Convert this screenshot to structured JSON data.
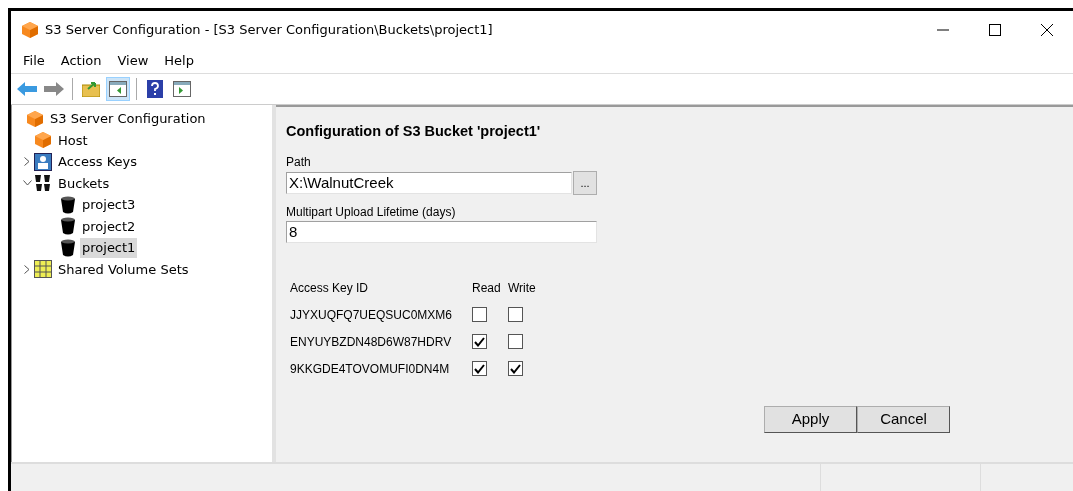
{
  "window": {
    "title": "S3 Server Configuration - [S3 Server Configuration\\Buckets\\project1]"
  },
  "menu": [
    "File",
    "Action",
    "View",
    "Help"
  ],
  "toolbar": [
    {
      "kind": "back",
      "selected": false
    },
    {
      "kind": "forward",
      "selected": false
    },
    {
      "kind": "up",
      "selected": false
    },
    {
      "kind": "pane",
      "selected": true
    },
    {
      "kind": "help",
      "selected": false
    },
    {
      "kind": "panel",
      "selected": false
    }
  ],
  "tree": [
    {
      "label": "S3 Server Configuration",
      "kind": "server",
      "selected": false,
      "children": [
        {
          "label": "Host",
          "kind": "server",
          "selected": false
        },
        {
          "label": "Access Keys",
          "kind": "keys",
          "selected": false,
          "expanded": false
        },
        {
          "label": "Buckets",
          "kind": "buckets",
          "selected": false,
          "expanded": true,
          "children": [
            {
              "label": "project3",
              "kind": "bucket",
              "selected": false
            },
            {
              "label": "project2",
              "kind": "bucket",
              "selected": false
            },
            {
              "label": "project1",
              "kind": "bucket",
              "selected": true
            }
          ]
        },
        {
          "label": "Shared Volume Sets",
          "kind": "volumes",
          "selected": false,
          "expanded": false
        }
      ]
    }
  ],
  "form": {
    "heading": "Configuration of S3 Bucket 'project1'",
    "path": {
      "label": "Path",
      "value": "X:\\WalnutCreek",
      "browse": "..."
    },
    "lifetime": {
      "label": "Multipart Upload Lifetime (days)",
      "value": "8"
    },
    "access": {
      "columns": [
        "Access Key ID",
        "Read",
        "Write"
      ],
      "rows": [
        {
          "key": "JJYXUQFQ7UEQSUC0MXM6",
          "read": false,
          "write": false
        },
        {
          "key": "ENYUYBZDN48D6W87HDRV",
          "read": true,
          "write": false
        },
        {
          "key": "9KKGDE4TOVOMUFI0DN4M",
          "read": true,
          "write": true
        }
      ]
    },
    "buttons": [
      "Apply",
      "Cancel"
    ]
  }
}
